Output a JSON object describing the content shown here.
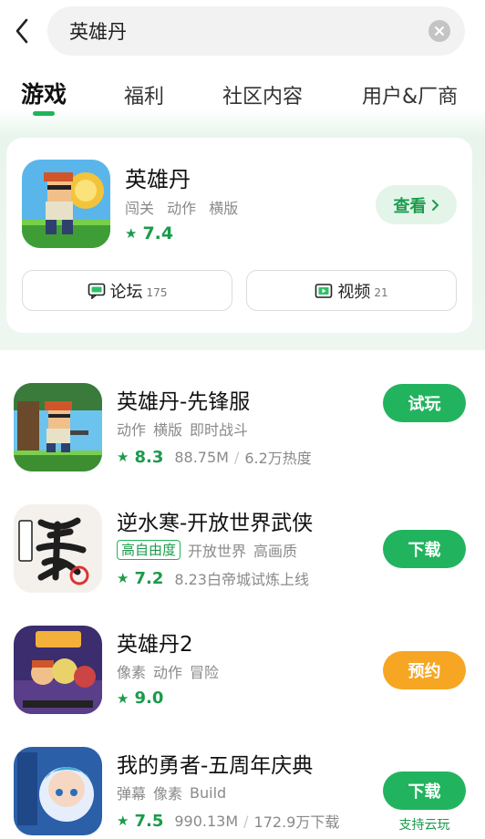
{
  "search": {
    "query": "英雄丹"
  },
  "tabs": [
    {
      "label": "游戏",
      "active": true
    },
    {
      "label": "福利",
      "active": false
    },
    {
      "label": "社区内容",
      "active": false
    },
    {
      "label": "用户&厂商",
      "active": false
    }
  ],
  "featured": {
    "title": "英雄丹",
    "tags": [
      "闯关",
      "动作",
      "横版"
    ],
    "rating": "7.4",
    "view_label": "查看",
    "forum_label": "论坛",
    "forum_count": "175",
    "video_label": "视频",
    "video_count": "21"
  },
  "games": [
    {
      "title": "英雄丹-先锋服",
      "tags": [
        "动作",
        "横版",
        "即时战斗"
      ],
      "rating": "8.3",
      "size": "88.75M",
      "stat": "6.2万热度",
      "button": "试玩"
    },
    {
      "title": "逆水寒-开放世界武侠",
      "badge": "高自由度",
      "tags": [
        "开放世界",
        "高画质"
      ],
      "rating": "7.2",
      "note": "8.23白帝城试炼上线",
      "button": "下载"
    },
    {
      "title": "英雄丹2",
      "tags": [
        "像素",
        "动作",
        "冒险"
      ],
      "rating": "9.0",
      "button": "预约"
    },
    {
      "title": "我的勇者-五周年庆典",
      "tags": [
        "弹幕",
        "像素",
        "Build"
      ],
      "rating": "7.5",
      "size": "990.13M",
      "stat": "172.9万下载",
      "button": "下载",
      "sub_label": "支持云玩"
    }
  ],
  "colors": {
    "accent": "#22b35e",
    "orange": "#f7a623",
    "rating": "#1a9b4b"
  },
  "icons": [
    "back-arrow-icon",
    "clear-icon",
    "star-icon",
    "chat-icon",
    "video-icon",
    "chevron-right-icon"
  ]
}
